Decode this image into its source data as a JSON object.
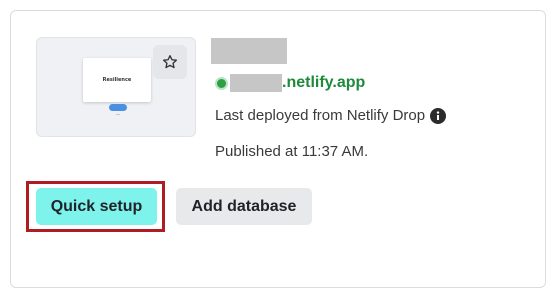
{
  "site": {
    "thumbnail_text": "Resilience",
    "url_suffix": ".netlify.app",
    "deploy_text": "Last deployed from Netlify Drop",
    "published_text": "Published at 11:37 AM.",
    "status_color": "#2ea043"
  },
  "actions": {
    "quick_setup_label": "Quick setup",
    "add_database_label": "Add database",
    "quick_setup_color": "#7df3ec"
  },
  "icons": {
    "favorite": "star-icon",
    "info": "info-icon"
  }
}
